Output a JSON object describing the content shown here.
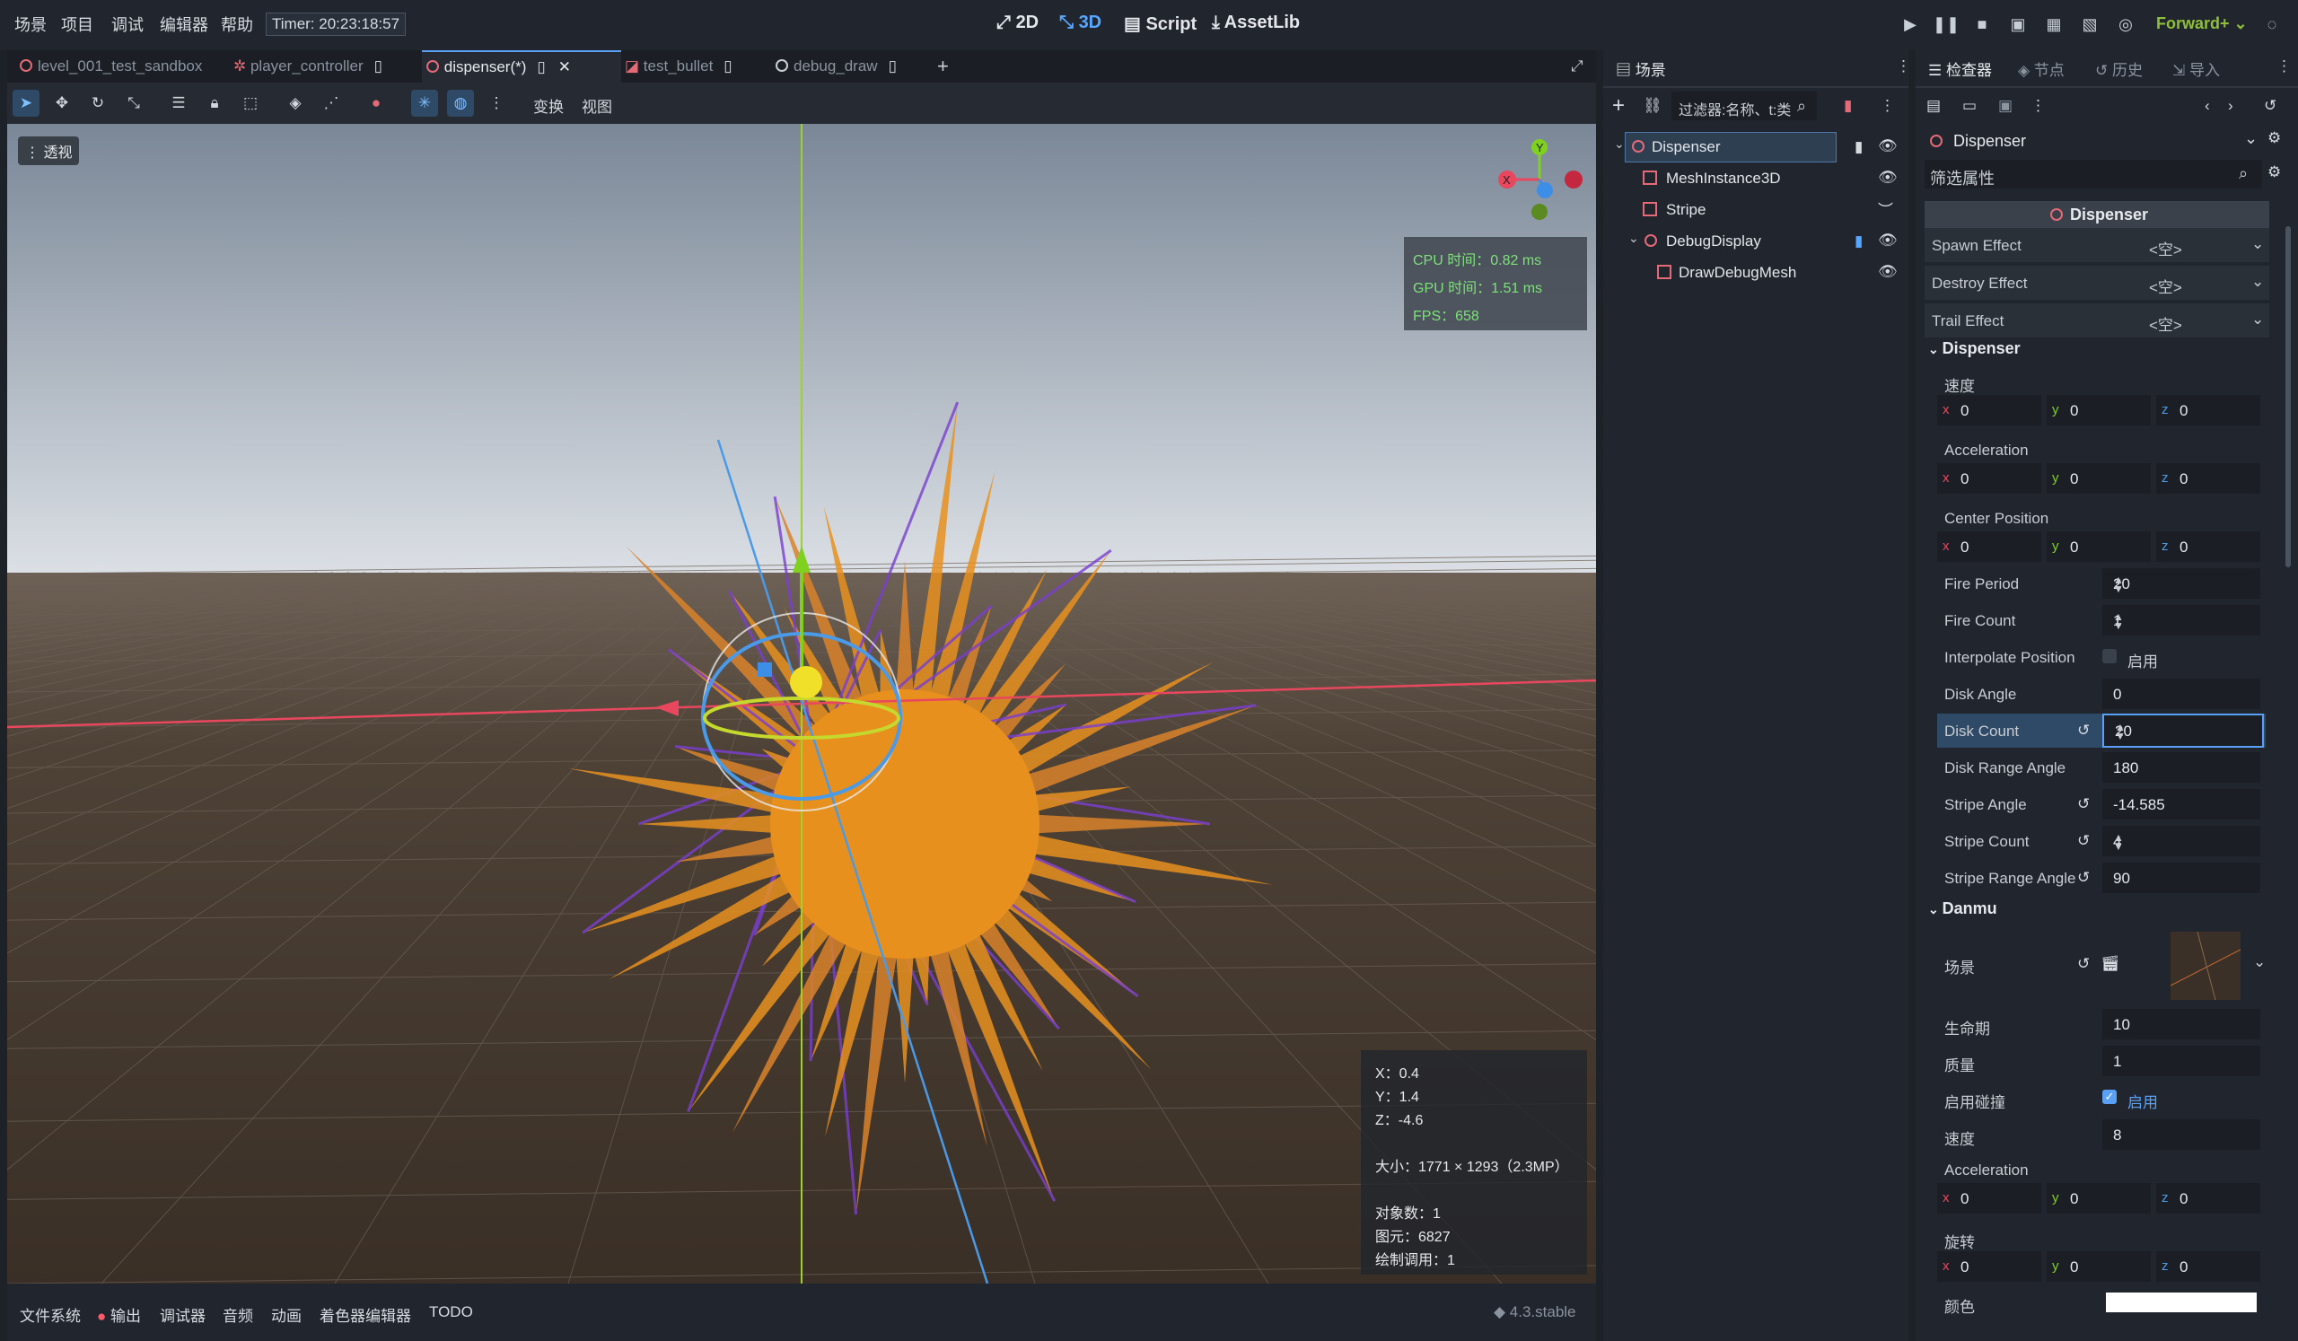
{
  "menu": {
    "items": [
      "场景",
      "项目",
      "调试",
      "编辑器",
      "帮助"
    ],
    "timer": "Timer: 20:23:18:57"
  },
  "modes": {
    "two_d": "2D",
    "three_d": "3D",
    "script": "Script",
    "assetlib": "AssetLib"
  },
  "renderer": "Forward+",
  "tabs": [
    "level_001_test_sandbox",
    "player_controller",
    "dispenser(*)",
    "test_bullet",
    "debug_draw"
  ],
  "toolbar": {
    "transform": "变换",
    "view": "视图"
  },
  "viewport": {
    "perspective": "透视",
    "gizmo": {
      "y": "Y",
      "x": "X"
    },
    "perf": {
      "cpu": "CPU 时间：0.82 ms",
      "gpu": "GPU 时间：1.51 ms",
      "fps": "FPS：658"
    },
    "stats": {
      "x": "X：0.4",
      "y": "Y：1.4",
      "z": "Z：-4.6",
      "size": "大小：1771 × 1293（2.3MP）",
      "objects": "对象数：1",
      "primitives": "图元：6827",
      "draw_calls": "绘制调用：1"
    }
  },
  "bottom": {
    "tabs": [
      "文件系统",
      "输出",
      "调试器",
      "音频",
      "动画",
      "着色器编辑器",
      "TODO"
    ],
    "version": "4.3.stable"
  },
  "scene": {
    "tab": "场景",
    "filter_placeholder": "过滤器:名称、t:类",
    "nodes": [
      "Dispenser",
      "MeshInstance3D",
      "Stripe",
      "DebugDisplay",
      "DrawDebugMesh"
    ]
  },
  "inspector": {
    "tabs": [
      "检查器",
      "节点",
      "历史",
      "导入"
    ],
    "object": "Dispenser",
    "filter_placeholder": "筛选属性",
    "class_header": "Dispenser",
    "effects": [
      {
        "label": "Spawn Effect",
        "value": "<空>"
      },
      {
        "label": "Destroy Effect",
        "value": "<空>"
      },
      {
        "label": "Trail Effect",
        "value": "<空>"
      }
    ],
    "dispenser_section": "Dispenser",
    "speed_label": "速度",
    "speed": [
      "0",
      "0",
      "0"
    ],
    "acceleration_label": "Acceleration",
    "acceleration": [
      "0",
      "0",
      "0"
    ],
    "center_label": "Center Position",
    "center": [
      "0",
      "0",
      "0"
    ],
    "props": [
      {
        "label": "Fire Period",
        "value": "20"
      },
      {
        "label": "Fire Count",
        "value": "1"
      },
      {
        "label": "Interpolate Position",
        "value": "启用"
      },
      {
        "label": "Disk Angle",
        "value": "0"
      },
      {
        "label": "Disk Count",
        "value": "20"
      },
      {
        "label": "Disk Range Angle",
        "value": "180"
      },
      {
        "label": "Stripe Angle",
        "value": "-14.585"
      },
      {
        "label": "Stripe Count",
        "value": "4"
      },
      {
        "label": "Stripe Range Angle",
        "value": "90"
      }
    ],
    "danmu_section": "Danmu",
    "scene_label": "场景",
    "lifetime_label": "生命期",
    "lifetime": "10",
    "mass_label": "质量",
    "mass": "1",
    "collision_label": "启用碰撞",
    "collision": "启用",
    "danmu_speed_label": "速度",
    "danmu_speed": "8",
    "danmu_accel_label": "Acceleration",
    "danmu_accel": [
      "0",
      "0",
      "0"
    ],
    "rotation_label": "旋转",
    "rotation": [
      "0",
      "0",
      "0"
    ],
    "color_label": "颜色",
    "color_value": "#ffffff"
  }
}
